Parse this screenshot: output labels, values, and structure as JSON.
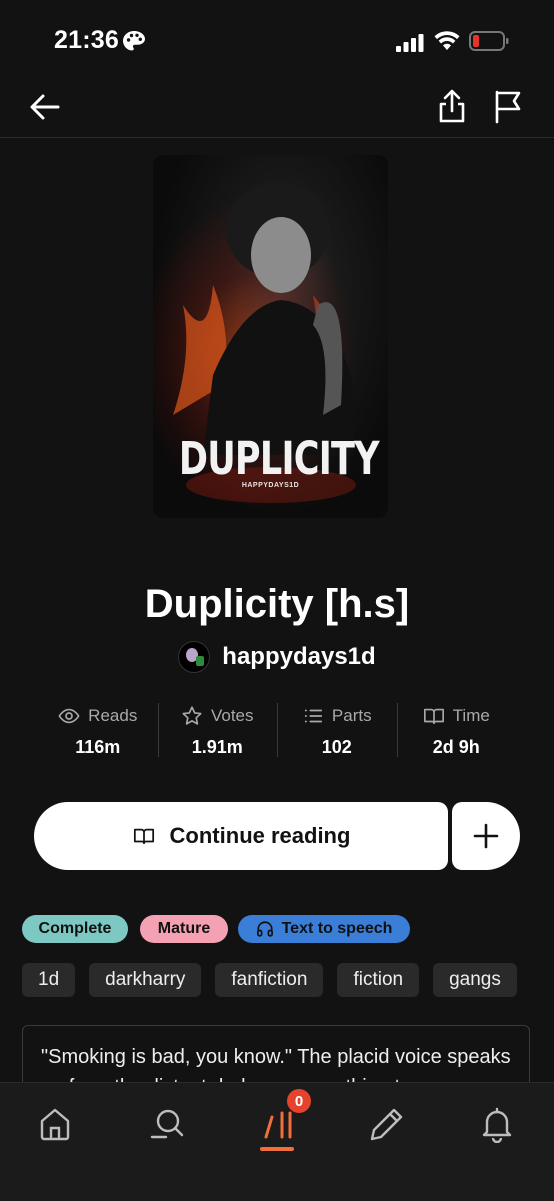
{
  "status_bar": {
    "time": "21:36",
    "icons": [
      "palette-icon",
      "signal-icon",
      "wifi-icon",
      "battery-low-icon"
    ]
  },
  "top_nav": {
    "icons": [
      "back-arrow-icon",
      "share-icon",
      "flag-icon"
    ]
  },
  "cover": {
    "title": "DUPLICITY",
    "subtitle": "HAPPYDAYS1D"
  },
  "story": {
    "title": "Duplicity [h.s]",
    "author": "happydays1d"
  },
  "stats": [
    {
      "label": "Reads",
      "value": "116m",
      "icon": "eye-icon"
    },
    {
      "label": "Votes",
      "value": "1.91m",
      "icon": "star-icon"
    },
    {
      "label": "Parts",
      "value": "102",
      "icon": "list-icon"
    },
    {
      "label": "Time",
      "value": "2d 9h",
      "icon": "book-icon"
    }
  ],
  "actions": {
    "continue_label": "Continue reading",
    "add_icon": "plus-icon"
  },
  "badges": {
    "complete": "Complete",
    "mature": "Mature",
    "tts": "Text to speech"
  },
  "tags": [
    "1d",
    "darkharry",
    "fanfiction",
    "fiction",
    "gangs"
  ],
  "description": "\"Smoking is bad, you know.\" The placid voice speaks up from the distant dark corner, nothing to",
  "bottom_nav": {
    "library_badge": "0",
    "icons": [
      "home-icon",
      "search-icon",
      "library-icon",
      "pencil-icon",
      "bell-icon"
    ]
  },
  "colors": {
    "accent": "#f26f3b",
    "badge_complete": "#7ec8c4",
    "badge_mature": "#f4a1b4",
    "badge_tts": "#3a7ed8",
    "background": "#121212"
  }
}
